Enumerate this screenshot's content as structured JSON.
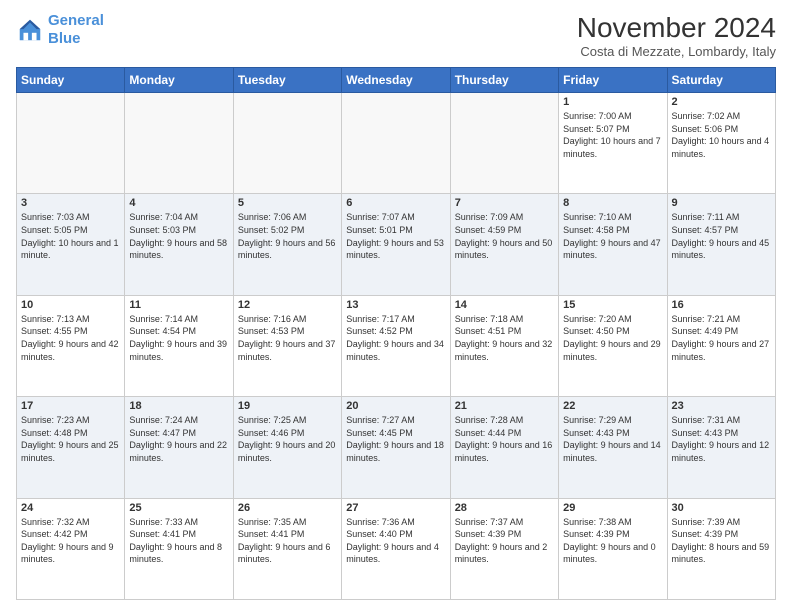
{
  "logo": {
    "line1": "General",
    "line2": "Blue"
  },
  "title": "November 2024",
  "subtitle": "Costa di Mezzate, Lombardy, Italy",
  "weekdays": [
    "Sunday",
    "Monday",
    "Tuesday",
    "Wednesday",
    "Thursday",
    "Friday",
    "Saturday"
  ],
  "weeks": [
    [
      {
        "day": "",
        "info": ""
      },
      {
        "day": "",
        "info": ""
      },
      {
        "day": "",
        "info": ""
      },
      {
        "day": "",
        "info": ""
      },
      {
        "day": "",
        "info": ""
      },
      {
        "day": "1",
        "info": "Sunrise: 7:00 AM\nSunset: 5:07 PM\nDaylight: 10 hours and 7 minutes."
      },
      {
        "day": "2",
        "info": "Sunrise: 7:02 AM\nSunset: 5:06 PM\nDaylight: 10 hours and 4 minutes."
      }
    ],
    [
      {
        "day": "3",
        "info": "Sunrise: 7:03 AM\nSunset: 5:05 PM\nDaylight: 10 hours and 1 minute."
      },
      {
        "day": "4",
        "info": "Sunrise: 7:04 AM\nSunset: 5:03 PM\nDaylight: 9 hours and 58 minutes."
      },
      {
        "day": "5",
        "info": "Sunrise: 7:06 AM\nSunset: 5:02 PM\nDaylight: 9 hours and 56 minutes."
      },
      {
        "day": "6",
        "info": "Sunrise: 7:07 AM\nSunset: 5:01 PM\nDaylight: 9 hours and 53 minutes."
      },
      {
        "day": "7",
        "info": "Sunrise: 7:09 AM\nSunset: 4:59 PM\nDaylight: 9 hours and 50 minutes."
      },
      {
        "day": "8",
        "info": "Sunrise: 7:10 AM\nSunset: 4:58 PM\nDaylight: 9 hours and 47 minutes."
      },
      {
        "day": "9",
        "info": "Sunrise: 7:11 AM\nSunset: 4:57 PM\nDaylight: 9 hours and 45 minutes."
      }
    ],
    [
      {
        "day": "10",
        "info": "Sunrise: 7:13 AM\nSunset: 4:55 PM\nDaylight: 9 hours and 42 minutes."
      },
      {
        "day": "11",
        "info": "Sunrise: 7:14 AM\nSunset: 4:54 PM\nDaylight: 9 hours and 39 minutes."
      },
      {
        "day": "12",
        "info": "Sunrise: 7:16 AM\nSunset: 4:53 PM\nDaylight: 9 hours and 37 minutes."
      },
      {
        "day": "13",
        "info": "Sunrise: 7:17 AM\nSunset: 4:52 PM\nDaylight: 9 hours and 34 minutes."
      },
      {
        "day": "14",
        "info": "Sunrise: 7:18 AM\nSunset: 4:51 PM\nDaylight: 9 hours and 32 minutes."
      },
      {
        "day": "15",
        "info": "Sunrise: 7:20 AM\nSunset: 4:50 PM\nDaylight: 9 hours and 29 minutes."
      },
      {
        "day": "16",
        "info": "Sunrise: 7:21 AM\nSunset: 4:49 PM\nDaylight: 9 hours and 27 minutes."
      }
    ],
    [
      {
        "day": "17",
        "info": "Sunrise: 7:23 AM\nSunset: 4:48 PM\nDaylight: 9 hours and 25 minutes."
      },
      {
        "day": "18",
        "info": "Sunrise: 7:24 AM\nSunset: 4:47 PM\nDaylight: 9 hours and 22 minutes."
      },
      {
        "day": "19",
        "info": "Sunrise: 7:25 AM\nSunset: 4:46 PM\nDaylight: 9 hours and 20 minutes."
      },
      {
        "day": "20",
        "info": "Sunrise: 7:27 AM\nSunset: 4:45 PM\nDaylight: 9 hours and 18 minutes."
      },
      {
        "day": "21",
        "info": "Sunrise: 7:28 AM\nSunset: 4:44 PM\nDaylight: 9 hours and 16 minutes."
      },
      {
        "day": "22",
        "info": "Sunrise: 7:29 AM\nSunset: 4:43 PM\nDaylight: 9 hours and 14 minutes."
      },
      {
        "day": "23",
        "info": "Sunrise: 7:31 AM\nSunset: 4:43 PM\nDaylight: 9 hours and 12 minutes."
      }
    ],
    [
      {
        "day": "24",
        "info": "Sunrise: 7:32 AM\nSunset: 4:42 PM\nDaylight: 9 hours and 9 minutes."
      },
      {
        "day": "25",
        "info": "Sunrise: 7:33 AM\nSunset: 4:41 PM\nDaylight: 9 hours and 8 minutes."
      },
      {
        "day": "26",
        "info": "Sunrise: 7:35 AM\nSunset: 4:41 PM\nDaylight: 9 hours and 6 minutes."
      },
      {
        "day": "27",
        "info": "Sunrise: 7:36 AM\nSunset: 4:40 PM\nDaylight: 9 hours and 4 minutes."
      },
      {
        "day": "28",
        "info": "Sunrise: 7:37 AM\nSunset: 4:39 PM\nDaylight: 9 hours and 2 minutes."
      },
      {
        "day": "29",
        "info": "Sunrise: 7:38 AM\nSunset: 4:39 PM\nDaylight: 9 hours and 0 minutes."
      },
      {
        "day": "30",
        "info": "Sunrise: 7:39 AM\nSunset: 4:39 PM\nDaylight: 8 hours and 59 minutes."
      }
    ]
  ]
}
